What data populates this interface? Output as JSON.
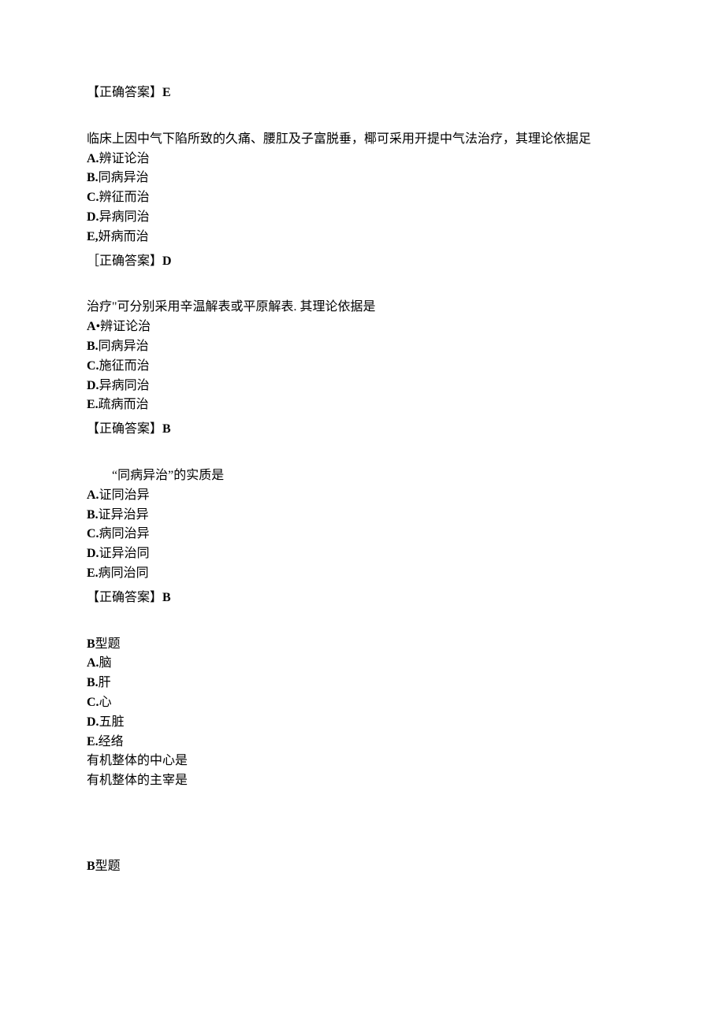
{
  "q0": {
    "answer_label": "【正确答案】",
    "answer_letter": "E"
  },
  "q1": {
    "stem": "临床上因中气下陷所致的久痛、腰肛及子富脱垂，椰可采用开提中气法治疗，其理论依据足",
    "opts": {
      "a": "A.辨证论治",
      "b": "B.同病异治",
      "c": "C.辨征而治",
      "d": "D.异病同治",
      "e": "E,妍病而治"
    },
    "answer_label": "［正确答案】",
    "answer_letter": "D"
  },
  "q2": {
    "stem": "治疗\"可分别采用辛温解表或平原解表. 其理论依据是",
    "opts": {
      "a": "A•辨证论治",
      "b": "B.同病异治",
      "c": "C.施征而治",
      "d": "D.异病同治",
      "e": "E.疏病而治"
    },
    "answer_label": "【正确答案】",
    "answer_letter": "B"
  },
  "q3": {
    "stem": "“同病异治”的实质是",
    "opts": {
      "a": "A.证同治异",
      "b": "B.证异治异",
      "c": "C.病同治异",
      "d": "D.证异治同",
      "e": "E.病同治同"
    },
    "answer_label": "【正确答案】",
    "answer_letter": "B"
  },
  "q4": {
    "header": "B型题",
    "opts": {
      "a": "A.脑",
      "b": "B.肝",
      "c": "C.心",
      "d": "D.五脏",
      "e": "E.经络"
    },
    "sub1": "有机整体的中心是",
    "sub2": "有机整体的主宰是"
  },
  "q5": {
    "header": "B型题"
  }
}
